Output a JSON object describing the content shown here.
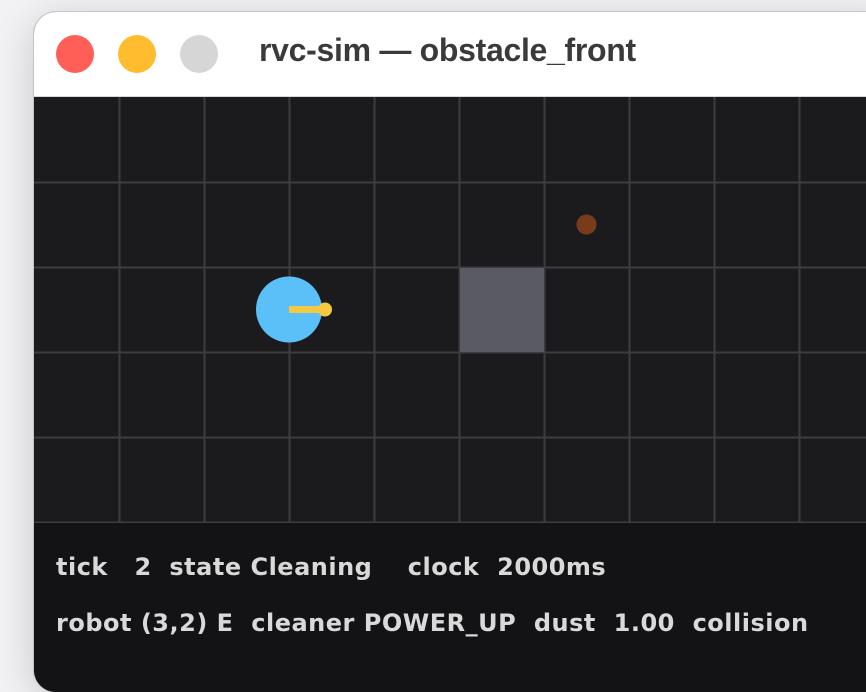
{
  "window": {
    "title": "rvc-sim — obstacle_front"
  },
  "arena": {
    "columns": 10,
    "rows": 5,
    "colors": {
      "background": "#1b1b1e",
      "grid_line": "#3d3d40",
      "obstacle": "#5a5a62",
      "robot": "#5bc0f8",
      "heading": "#f5c842",
      "dust": "#7a3a1c"
    },
    "robot": {
      "col": 3,
      "row": 2,
      "heading": "E"
    },
    "obstacle": {
      "col": 5,
      "row": 2
    },
    "dust": {
      "col": 6,
      "row": 1
    }
  },
  "status": {
    "tick_label": "tick",
    "tick_value": "2",
    "state_label": "state",
    "state_value": "Cleaning",
    "clock_label": "clock",
    "clock_value": "2000ms",
    "robot_label": "robot",
    "robot_value": "(3,2) E",
    "cleaner_label": "cleaner",
    "cleaner_value": "POWER_UP",
    "dust_label": "dust",
    "dust_value": "1.00",
    "collision_label": "collision"
  }
}
